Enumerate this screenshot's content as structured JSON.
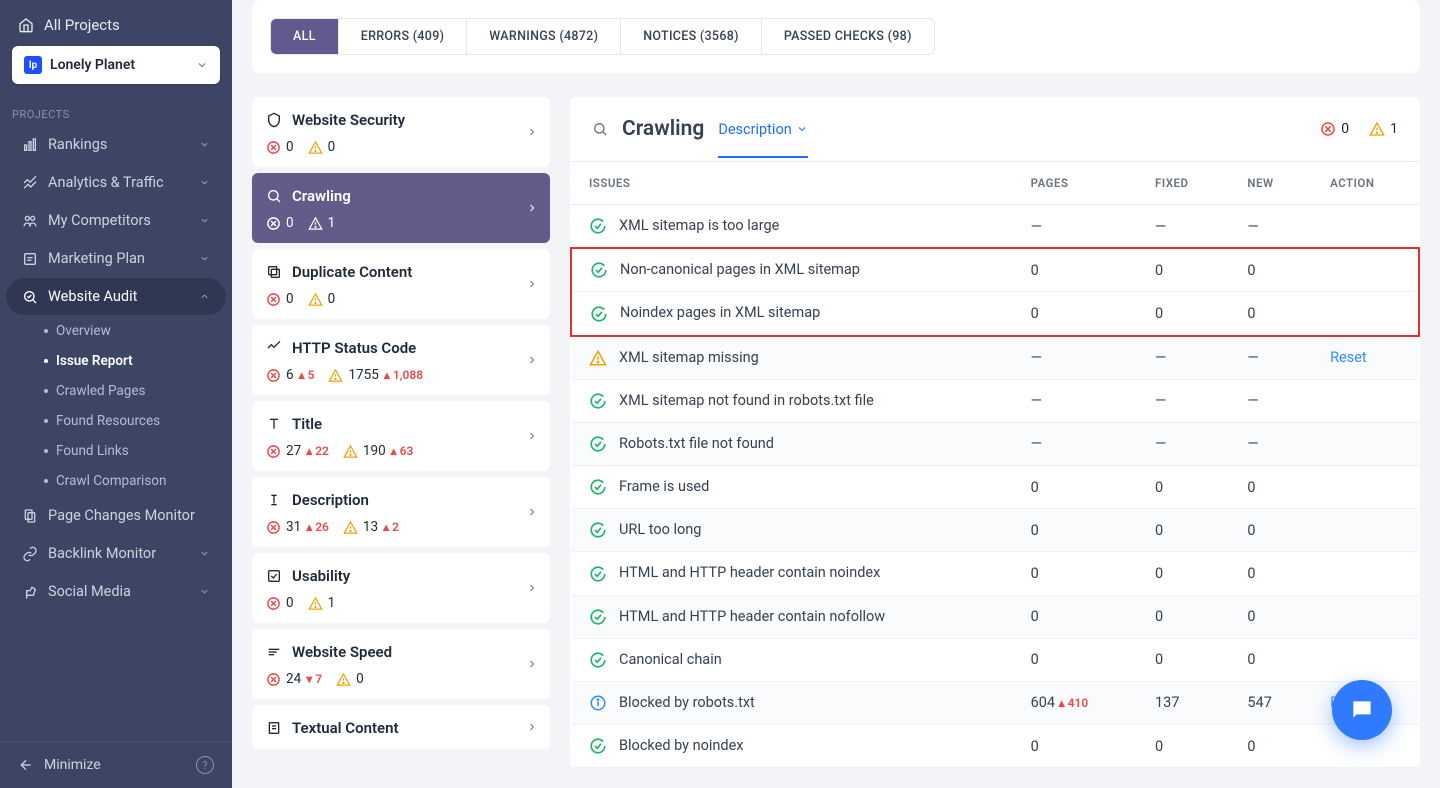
{
  "sidebar": {
    "all_projects": "All Projects",
    "project_name": "Lonely Planet",
    "project_badge": "lp",
    "section_label": "PROJECTS",
    "nav": [
      {
        "label": "Rankings"
      },
      {
        "label": "Analytics & Traffic"
      },
      {
        "label": "My Competitors"
      },
      {
        "label": "Marketing Plan"
      },
      {
        "label": "Website Audit",
        "expanded": true,
        "subs": [
          {
            "label": "Overview"
          },
          {
            "label": "Issue Report",
            "active": true
          },
          {
            "label": "Crawled Pages"
          },
          {
            "label": "Found Resources"
          },
          {
            "label": "Found Links"
          },
          {
            "label": "Crawl Comparison"
          }
        ]
      },
      {
        "label": "Page Changes Monitor",
        "nochev": true
      },
      {
        "label": "Backlink Monitor"
      },
      {
        "label": "Social Media"
      }
    ],
    "minimize": "Minimize"
  },
  "tabs": [
    {
      "label": "ALL",
      "active": true
    },
    {
      "label": "ERRORS (409)"
    },
    {
      "label": "WARNINGS (4872)"
    },
    {
      "label": "NOTICES (3568)"
    },
    {
      "label": "PASSED CHECKS (98)"
    }
  ],
  "categories": [
    {
      "name": "Website Security",
      "err": "0",
      "warn": "0"
    },
    {
      "name": "Crawling",
      "err": "0",
      "warn": "1",
      "active": true
    },
    {
      "name": "Duplicate Content",
      "err": "0",
      "warn": "0"
    },
    {
      "name": "HTTP Status Code",
      "err": "6",
      "err_delta": "▴ 5",
      "warn": "1755",
      "warn_delta": "▴ 1,088"
    },
    {
      "name": "Title",
      "err": "27",
      "err_delta": "▴ 22",
      "warn": "190",
      "warn_delta": "▴ 63"
    },
    {
      "name": "Description",
      "err": "31",
      "err_delta": "▴ 26",
      "warn": "13",
      "warn_delta": "▴ 2"
    },
    {
      "name": "Usability",
      "err": "0",
      "warn": "1"
    },
    {
      "name": "Website Speed",
      "err": "24",
      "err_delta": "▾ 7",
      "warn": "0"
    },
    {
      "name": "Textual Content"
    }
  ],
  "detail": {
    "title": "Crawling",
    "view_mode": "Description",
    "hdr_err": "0",
    "hdr_warn": "1",
    "columns": {
      "issues": "ISSUES",
      "pages": "PAGES",
      "fixed": "FIXED",
      "new": "NEW",
      "action": "ACTION"
    },
    "rows": [
      {
        "icon": "ok",
        "name": "XML sitemap is too large",
        "pages": "—",
        "fixed": "—",
        "new": "—"
      },
      {
        "icon": "ok",
        "name": "Non-canonical pages in XML sitemap",
        "pages": "0",
        "fixed": "0",
        "new": "0",
        "hl": "top"
      },
      {
        "icon": "ok",
        "name": "Noindex pages in XML sitemap",
        "pages": "0",
        "fixed": "0",
        "new": "0",
        "hl": "bot"
      },
      {
        "icon": "warn",
        "name": "XML sitemap missing",
        "pages": "—",
        "fixed": "—",
        "new": "—",
        "action": "Reset"
      },
      {
        "icon": "ok",
        "name": "XML sitemap not found in robots.txt file",
        "pages": "—",
        "fixed": "—",
        "new": "—"
      },
      {
        "icon": "ok",
        "name": "Robots.txt file not found",
        "pages": "—",
        "fixed": "—",
        "new": "—"
      },
      {
        "icon": "ok",
        "name": "Frame is used",
        "pages": "0",
        "fixed": "0",
        "new": "0"
      },
      {
        "icon": "ok",
        "name": "URL too long",
        "pages": "0",
        "fixed": "0",
        "new": "0"
      },
      {
        "icon": "ok",
        "name": "HTML and HTTP header contain noindex",
        "pages": "0",
        "fixed": "0",
        "new": "0"
      },
      {
        "icon": "ok",
        "name": "HTML and HTTP header contain nofollow",
        "pages": "0",
        "fixed": "0",
        "new": "0"
      },
      {
        "icon": "ok",
        "name": "Canonical chain",
        "pages": "0",
        "fixed": "0",
        "new": "0"
      },
      {
        "icon": "info",
        "name": "Blocked by robots.txt",
        "pages": "604",
        "pages_delta": "▴ 410",
        "fixed": "137",
        "new": "547",
        "action": "Reset"
      },
      {
        "icon": "ok",
        "name": "Blocked by noindex",
        "pages": "0",
        "fixed": "0",
        "new": "0"
      }
    ]
  }
}
